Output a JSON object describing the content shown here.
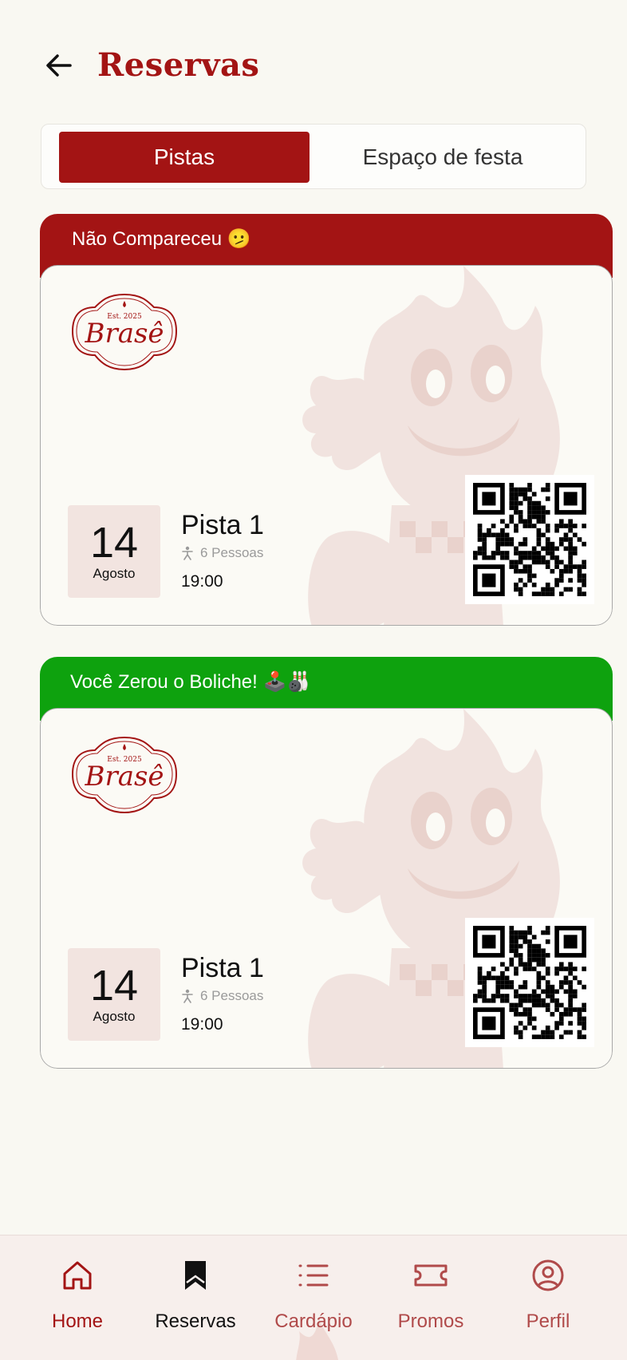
{
  "header": {
    "title": "Reservas",
    "back_icon": "arrow-left-icon"
  },
  "tabs": [
    {
      "label": "Pistas",
      "active": true
    },
    {
      "label": "Espaço de festa",
      "active": false
    }
  ],
  "colors": {
    "brand": "#a31414",
    "missed_banner": "#a31414",
    "strike_banner": "#0ea20e",
    "accent_soft": "#f2e4e0"
  },
  "reservations": [
    {
      "status": "Não Compareceu 🫤",
      "status_color": "#a31414",
      "logo": {
        "brand": "Brasê",
        "established": "Est. 2025"
      },
      "day": "14",
      "month": "Agosto",
      "lane": "Pista 1",
      "people": "6 Pessoas",
      "time": "19:00"
    },
    {
      "status": "Você Zerou o Boliche! 🕹️🎳",
      "status_color": "#0ea20e",
      "logo": {
        "brand": "Brasê",
        "established": "Est. 2025"
      },
      "day": "14",
      "month": "Agosto",
      "lane": "Pista 1",
      "people": "6 Pessoas",
      "time": "19:00"
    }
  ],
  "nav": [
    {
      "label": "Home",
      "icon": "home-icon"
    },
    {
      "label": "Reservas",
      "icon": "bookmark-icon",
      "active": true
    },
    {
      "label": "Cardápio",
      "icon": "list-icon"
    },
    {
      "label": "Promos",
      "icon": "ticket-icon"
    },
    {
      "label": "Perfil",
      "icon": "profile-icon"
    }
  ]
}
